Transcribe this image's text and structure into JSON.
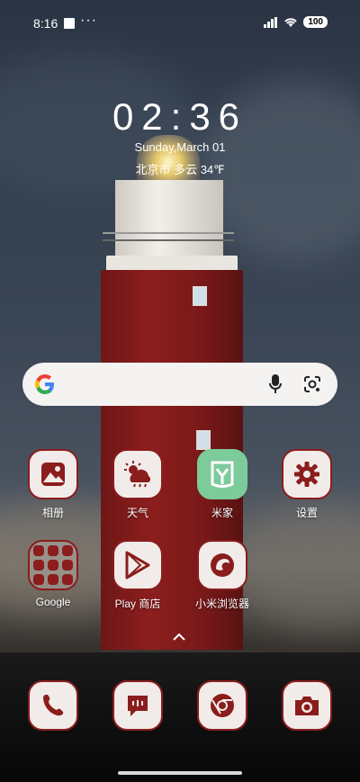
{
  "status": {
    "time": "8:16",
    "dots": "···",
    "battery": "100"
  },
  "clock": {
    "time": "02:36",
    "date": "Sunday,March 01",
    "weather": "北京市 多云 34℉"
  },
  "search": {
    "logo": "google-g-icon",
    "mic": "microphone-icon",
    "lens": "lens-icon"
  },
  "apps": {
    "row1": [
      {
        "label": "相册",
        "icon": "gallery-icon"
      },
      {
        "label": "天气",
        "icon": "weather-icon"
      },
      {
        "label": "米家",
        "icon": "mijia-icon"
      },
      {
        "label": "设置",
        "icon": "gear-icon"
      }
    ],
    "row2": [
      {
        "label": "Google",
        "icon": "google-folder-icon"
      },
      {
        "label": "Play 商店",
        "icon": "play-store-icon"
      },
      {
        "label": "小米浏览器",
        "icon": "browser-icon"
      }
    ]
  },
  "dock": [
    {
      "icon": "phone-icon"
    },
    {
      "icon": "messages-icon"
    },
    {
      "icon": "chrome-icon"
    },
    {
      "icon": "camera-icon"
    }
  ],
  "colors": {
    "accent": "#8b1d1d",
    "tile_bg": "#f1ecea",
    "mijia_green": "#7ccb9a"
  }
}
